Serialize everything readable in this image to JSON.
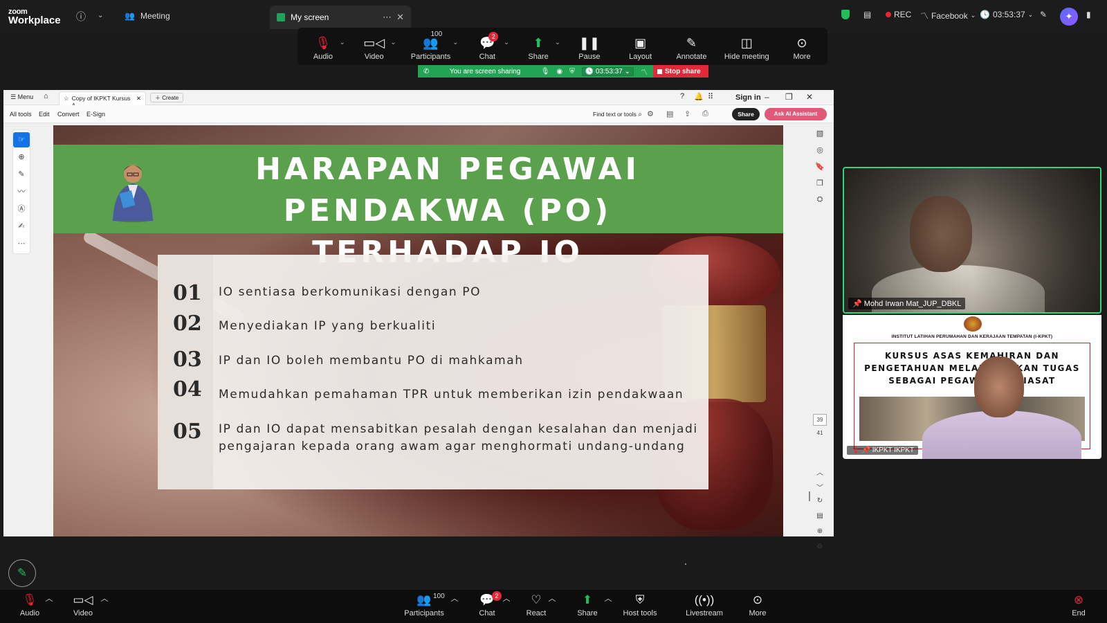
{
  "topbar": {
    "logo_small": "zoom",
    "logo_big": "Workplace",
    "meeting_label": "Meeting",
    "screen_tab_label": "My screen",
    "rec_label": "REC",
    "facebook_label": "Facebook",
    "clock_label": "03:53:37"
  },
  "controls": {
    "audio": "Audio",
    "video": "Video",
    "participants": "Participants",
    "participants_count": "100",
    "chat": "Chat",
    "chat_badge": "2",
    "share": "Share",
    "pause": "Pause",
    "layout": "Layout",
    "annotate": "Annotate",
    "hide_meeting": "Hide meeting",
    "more": "More"
  },
  "share_strip": {
    "message": "You are screen sharing",
    "timer": "03:53:37",
    "stop": "Stop share"
  },
  "pdf": {
    "menu_label": "Menu",
    "tab_title": "Copy of IKPKT Kursus A...",
    "create_label": "Create",
    "sign_in": "Sign in",
    "menu_all_tools": "All tools",
    "menu_edit": "Edit",
    "menu_convert": "Convert",
    "menu_esign": "E-Sign",
    "find_label": "Find text or tools",
    "share_label": "Share",
    "ai_label": "Ask AI Assistant",
    "page_current": "39",
    "page_total": "41"
  },
  "slide": {
    "title_line1": "HARAPAN PEGAWAI PENDAKWA (PO)",
    "title_line2": "TERHADAP IO",
    "items": [
      {
        "num": "01",
        "text": "IO sentiasa berkomunikasi dengan PO"
      },
      {
        "num": "02",
        "text": "Menyediakan IP yang berkualiti"
      },
      {
        "num": "03",
        "text": "IP dan IO boleh membantu PO di mahkamah"
      },
      {
        "num": "04",
        "text": "Memudahkan pemahaman TPR untuk memberikan izin pendakwaan"
      },
      {
        "num": "05",
        "text": "IP dan IO dapat mensabitkan pesalah dengan kesalahan dan menjadi pengajaran kepada orang awam agar menghormati undang-undang"
      }
    ]
  },
  "tiles": {
    "participant1_name": "Mohd Irwan Mat_JUP_DBKL",
    "participant2_name": "IKPKT IKPKT",
    "tile2_institute": "INSTITUT LATIHAN PERUMAHAN DAN KERAJAAN TEMPATAN (I-KPKT)",
    "tile2_title": "KURSUS ASAS KEMAHIRAN DAN PENGETAHUAN MELAKSANAKAN TUGAS SEBAGAI PEGAWAI PENYIASAT"
  },
  "bottom": {
    "audio": "Audio",
    "video": "Video",
    "participants": "Participants",
    "participants_count": "100",
    "chat": "Chat",
    "chat_badge": "2",
    "react": "React",
    "share": "Share",
    "host_tools": "Host tools",
    "livestream": "Livestream",
    "more": "More",
    "end": "End"
  },
  "colors": {
    "slide_green": "#5aa04d",
    "share_green": "#23a455",
    "stop_red": "#e02a3a",
    "active_speaker": "#2fd879"
  }
}
